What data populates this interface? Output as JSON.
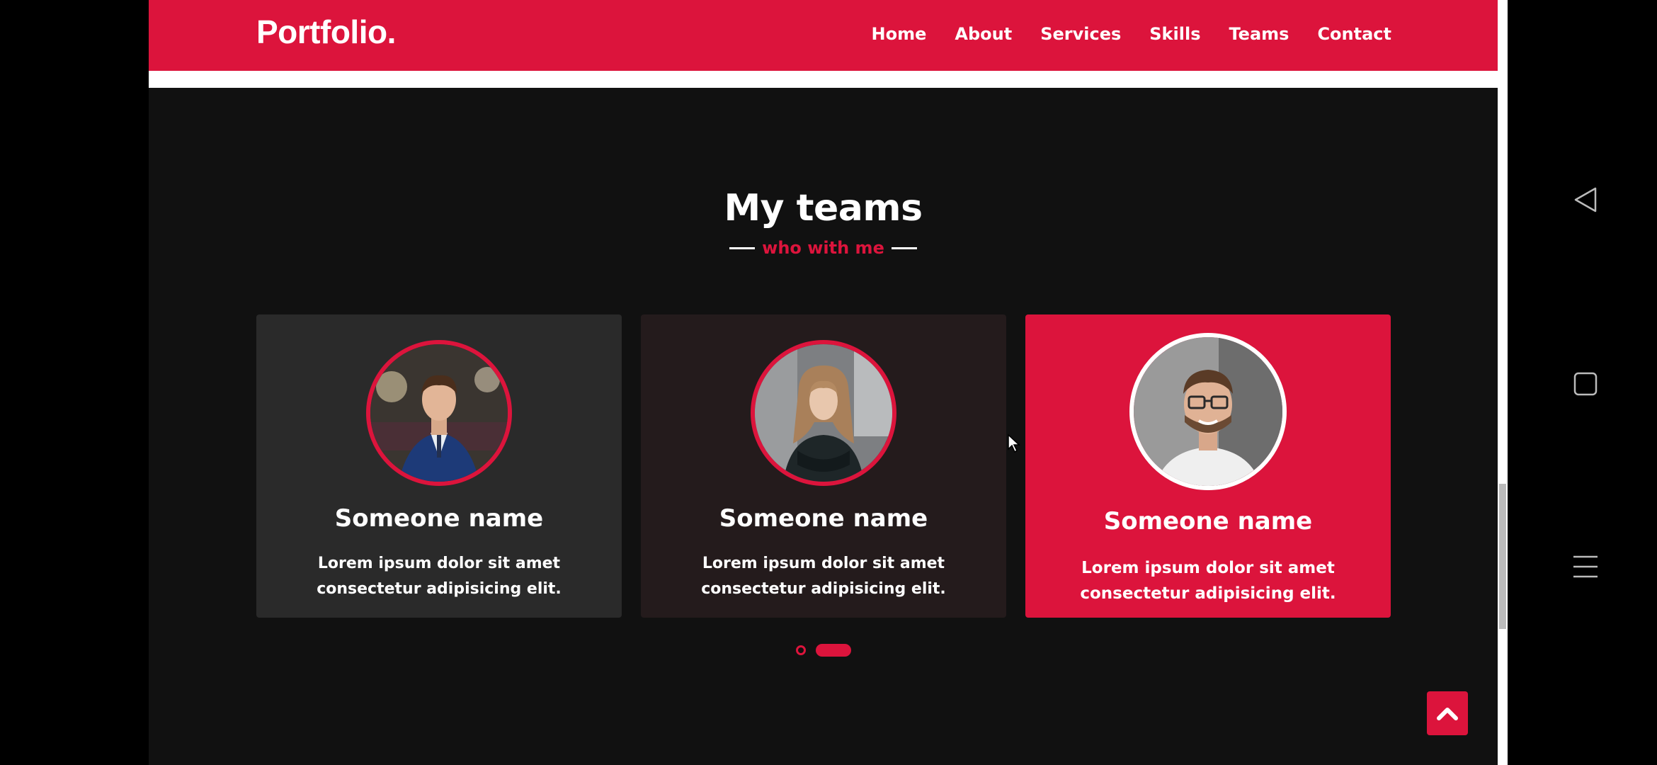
{
  "header": {
    "brand": "Portfolio.",
    "nav": [
      "Home",
      "About",
      "Services",
      "Skills",
      "Teams",
      "Contact"
    ]
  },
  "teams": {
    "title": "My teams",
    "subtitle": "who with me",
    "cards": [
      {
        "name": "Someone name",
        "desc_line1": "Lorem ipsum dolor sit amet",
        "desc_line2": "consectetur adipisicing elit."
      },
      {
        "name": "Someone name",
        "desc_line1": "Lorem ipsum dolor sit amet",
        "desc_line2": "consectetur adipisicing elit."
      },
      {
        "name": "Someone name",
        "desc_line1": "Lorem ipsum dolor sit amet",
        "desc_line2": "consectetur adipisicing elit."
      }
    ],
    "carousel": {
      "pages": 2,
      "active_page": 2
    }
  },
  "colors": {
    "accent": "#dc143c",
    "background": "#111111",
    "card": "#2a2a2a"
  },
  "icons": {
    "back_to_top": "chevron-up-icon",
    "system_back": "triangle-back-icon",
    "system_home": "square-home-icon",
    "system_menu": "hamburger-menu-icon"
  }
}
